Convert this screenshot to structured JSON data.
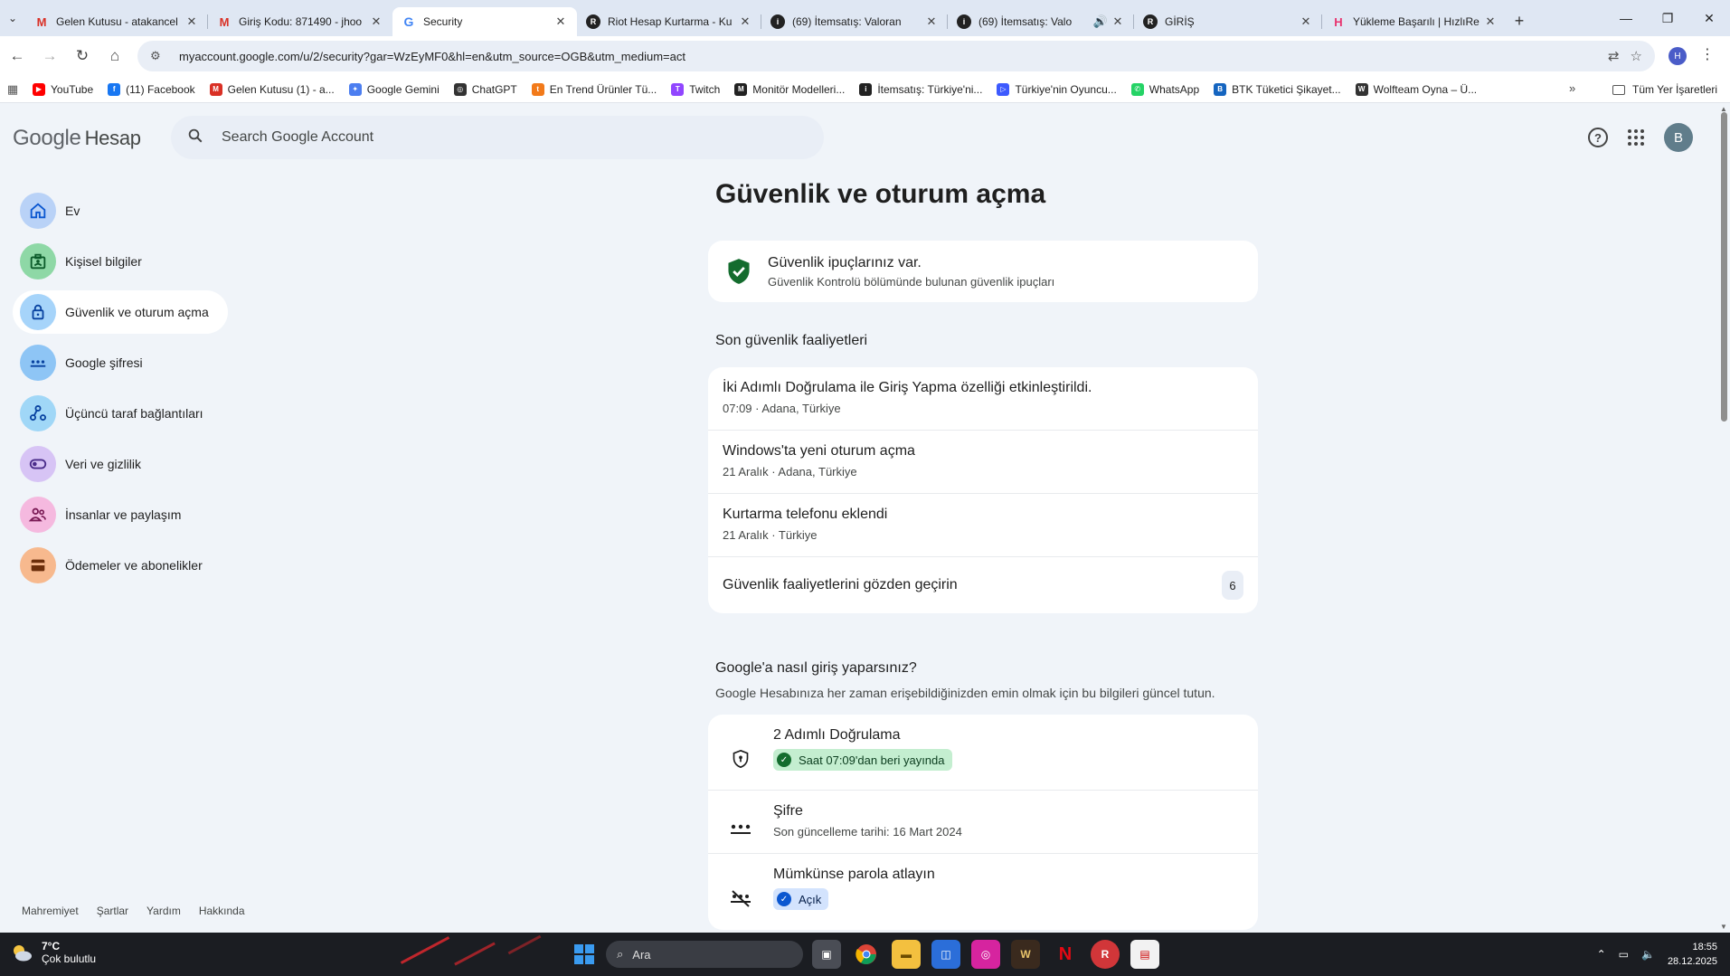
{
  "browser": {
    "tabs": [
      {
        "title": "Gelen Kutusu - atakancel",
        "icon": "gmail-icon",
        "color": "#d93025",
        "glyph": "M"
      },
      {
        "title": "Giriş Kodu: 871490 - jhoo",
        "icon": "gmail-icon",
        "color": "#d93025",
        "glyph": "M"
      },
      {
        "title": "Security",
        "icon": "google-g-icon",
        "color": "#4285f4",
        "glyph": "G",
        "active": true
      },
      {
        "title": "Riot Hesap Kurtarma - Ku",
        "icon": "riot-icon",
        "color": "#222222",
        "glyph": "R"
      },
      {
        "title": "(69) İtemsatış: Valoran",
        "icon": "itemsatis-icon",
        "color": "#222222",
        "glyph": "i"
      },
      {
        "title": "(69) İtemsatış: Valo",
        "icon": "itemsatis-icon",
        "color": "#222222",
        "glyph": "i",
        "audio": true
      },
      {
        "title": "GİRİŞ",
        "icon": "riot-icon",
        "color": "#222222",
        "glyph": "R"
      },
      {
        "title": "Yükleme Başarılı | HızlıRe",
        "icon": "hizlireels-icon",
        "color": "#e8336e",
        "glyph": "H"
      }
    ],
    "url": "myaccount.google.com/u/2/security?gar=WzEyMF0&hl=en&utm_source=OGB&utm_medium=act",
    "profile_initial": "H",
    "bookmarks": [
      {
        "label": "YouTube",
        "color": "#ff0000",
        "glyph": "▶"
      },
      {
        "label": "(11) Facebook",
        "color": "#1877f2",
        "glyph": "f"
      },
      {
        "label": "Gelen Kutusu (1) - a...",
        "color": "#d93025",
        "glyph": "M"
      },
      {
        "label": "Google Gemini",
        "color": "#4c7ef0",
        "glyph": "✦"
      },
      {
        "label": "ChatGPT",
        "color": "#333333",
        "glyph": "◎"
      },
      {
        "label": "En Trend Ürünler Tü...",
        "color": "#f27a1a",
        "glyph": "t"
      },
      {
        "label": "Twitch",
        "color": "#9146ff",
        "glyph": "T"
      },
      {
        "label": "Monitör Modelleri...",
        "color": "#222222",
        "glyph": "M"
      },
      {
        "label": "İtemsatış: Türkiye'ni...",
        "color": "#222222",
        "glyph": "i"
      },
      {
        "label": "Türkiye'nin Oyuncu...",
        "color": "#3d5afe",
        "glyph": "▷"
      },
      {
        "label": "WhatsApp",
        "color": "#25d366",
        "glyph": "✆"
      },
      {
        "label": "BTK Tüketici Şikayet...",
        "color": "#1565c0",
        "glyph": "B"
      },
      {
        "label": "Wolfteam Oyna – Ü...",
        "color": "#333333",
        "glyph": "W"
      }
    ],
    "all_bookmarks": "Tüm Yer İşaretleri"
  },
  "header": {
    "logo_google": "Google",
    "logo_product": "Hesap",
    "search_placeholder": "Search Google Account",
    "avatar_initial": "B"
  },
  "sidebar": {
    "items": [
      {
        "label": "Ev",
        "icon": "home-icon",
        "bg": "#b9d2f7"
      },
      {
        "label": "Kişisel bilgiler",
        "icon": "id-card-icon",
        "bg": "#8ed8a6"
      },
      {
        "label": "Güvenlik ve oturum açma",
        "icon": "lock-icon",
        "bg": "#a6d4fa",
        "active": true
      },
      {
        "label": "Google şifresi",
        "icon": "password-dots-icon",
        "bg": "#8ec5f5"
      },
      {
        "label": "Üçüncü taraf bağlantıları",
        "icon": "connections-icon",
        "bg": "#a0d7f7"
      },
      {
        "label": "Veri ve gizlilik",
        "icon": "toggle-icon",
        "bg": "#d7c4f5"
      },
      {
        "label": "İnsanlar ve paylaşım",
        "icon": "people-icon",
        "bg": "#f5b9df"
      },
      {
        "label": "Ödemeler ve abonelikler",
        "icon": "wallet-icon",
        "bg": "#f7b98e"
      }
    ],
    "footer": [
      "Mahremiyet",
      "Şartlar",
      "Yardım",
      "Hakkında"
    ]
  },
  "main": {
    "title": "Güvenlik ve oturum açma",
    "tips": {
      "title": "Güvenlik ipuçlarınız var.",
      "subtitle": "Güvenlik Kontrolü bölümünde bulunan güvenlik ipuçları"
    },
    "recent_title": "Son güvenlik faaliyetleri",
    "activities": [
      {
        "title": "İki Adımlı Doğrulama ile Giriş Yapma özelliği etkinleştirildi.",
        "sub": "07:09 · Adana, Türkiye"
      },
      {
        "title": "Windows'ta yeni oturum açma",
        "sub": "21 Aralık · Adana, Türkiye"
      },
      {
        "title": "Kurtarma telefonu eklendi",
        "sub": "21 Aralık · Türkiye"
      }
    ],
    "review": {
      "label": "Güvenlik faaliyetlerini gözden geçirin",
      "count": "6"
    },
    "signin_title": "Google'a nasıl giriş yaparsınız?",
    "signin_sub": "Google Hesabınıza her zaman erişebildiğinizden emin olmak için bu bilgileri güncel tutun.",
    "signin_items": [
      {
        "title": "2 Adımlı Doğrulama",
        "pill": "Saat 07:09'dan beri yayında",
        "icon": "shield-lock-icon"
      },
      {
        "title": "Şifre",
        "sub": "Son güncelleme tarihi: 16 Mart 2024",
        "icon": "password-dots-icon"
      },
      {
        "title": "Mümkünse parola atlayın",
        "pill": "Açık",
        "icon": "passkey-icon"
      }
    ]
  },
  "taskbar": {
    "temp": "7°C",
    "weather": "Çok bulutlu",
    "search": "Ara",
    "time": "18:55",
    "date": "28.12.2025"
  }
}
